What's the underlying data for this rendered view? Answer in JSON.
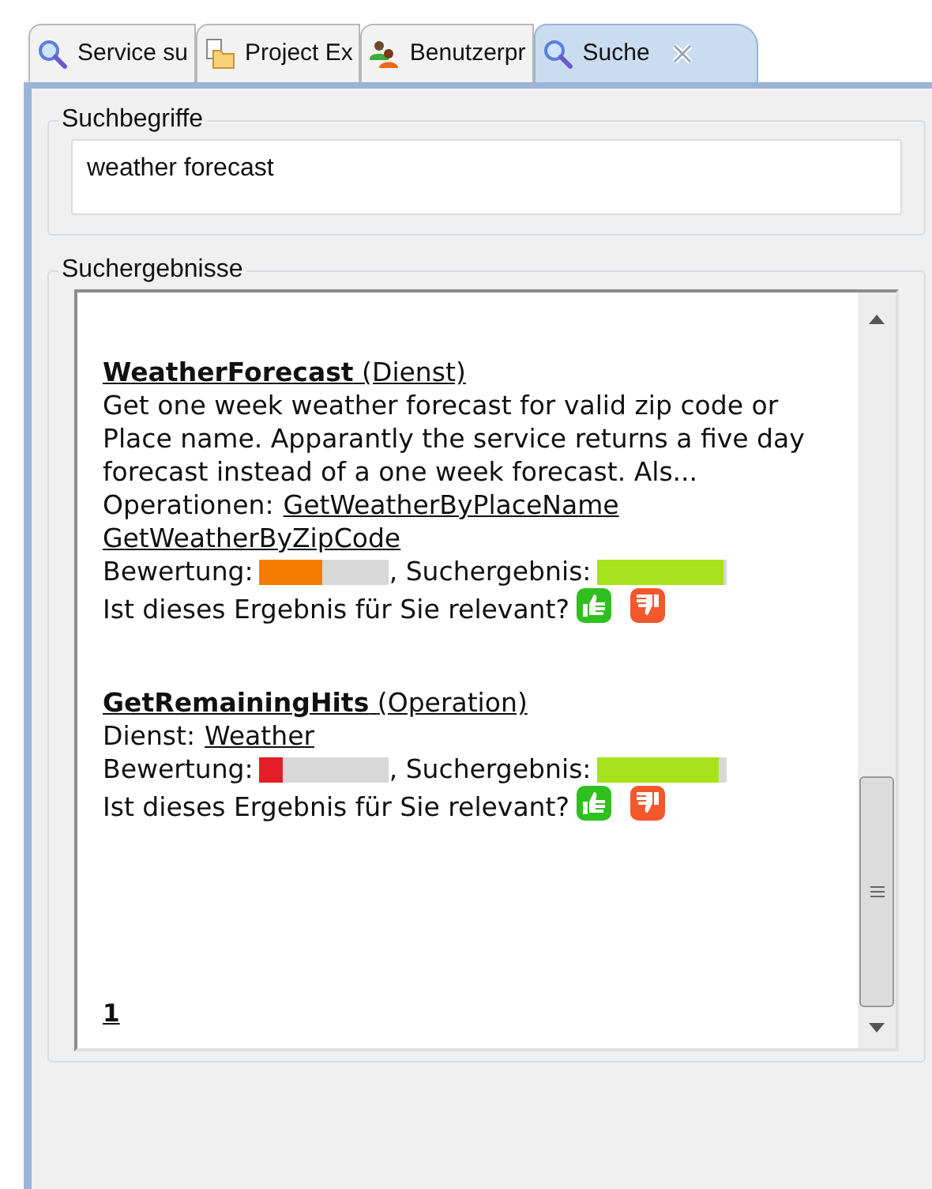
{
  "tabs": [
    {
      "label": "Service su",
      "selected": false,
      "closable": false,
      "kind": "search"
    },
    {
      "label": "Project Ex",
      "selected": false,
      "closable": false,
      "kind": "project"
    },
    {
      "label": "Benutzerpr",
      "selected": false,
      "closable": false,
      "kind": "users"
    },
    {
      "label": "Suche",
      "selected": true,
      "closable": true,
      "kind": "search"
    }
  ],
  "search_terms": {
    "legend": "Suchbegriffe",
    "value": "weather forecast"
  },
  "results": {
    "legend": "Suchergebnisse",
    "items": [
      {
        "name": "WeatherForecast",
        "type": "(Dienst)",
        "description": "Get one week weather forecast for valid zip code or Place name. Apparantly the service returns a five day forecast instead of a one week forecast. Als...",
        "links_label": "Operationen:",
        "links": [
          "GetWeatherByPlaceName",
          "GetWeatherByZipCode"
        ],
        "rating_label": "Bewertung:",
        "rating": {
          "level": 0.5,
          "color": "#f57c00"
        },
        "score_label": ", Suchergebnis:",
        "score": {
          "level": 1.0
        },
        "question": "Ist dieses Ergebnis für Sie relevant?"
      },
      {
        "name": "GetRemainingHits",
        "type": "(Operation)",
        "links_label": "Dienst:",
        "links": [
          "Weather"
        ],
        "rating_label": "Bewertung:",
        "rating": {
          "level": 0.18,
          "color": "#e41e26"
        },
        "score_label": ", Suchergebnis:",
        "score": {
          "level": 0.96
        },
        "question": "Ist dieses Ergebnis für Sie relevant?"
      }
    ],
    "pages": [
      {
        "label": "1",
        "selected": true
      }
    ]
  }
}
